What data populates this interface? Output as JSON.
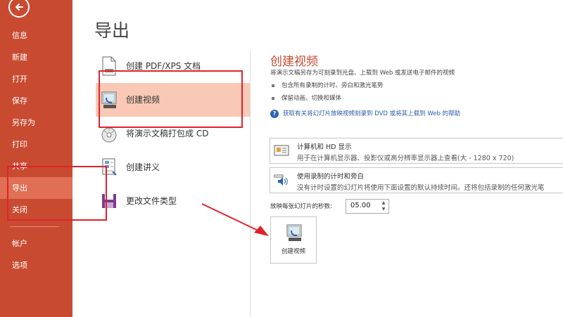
{
  "sidebar": {
    "items": [
      {
        "label": "信息"
      },
      {
        "label": "新建"
      },
      {
        "label": "打开"
      },
      {
        "label": "保存"
      },
      {
        "label": "另存为"
      },
      {
        "label": "打印"
      },
      {
        "label": "共享"
      },
      {
        "label": "导出"
      },
      {
        "label": "关闭"
      },
      {
        "label": "帐户"
      },
      {
        "label": "选项"
      }
    ]
  },
  "page": {
    "title": "导出"
  },
  "options": [
    {
      "label": "创建 PDF/XPS 文档",
      "icon": "pdf-document-icon"
    },
    {
      "label": "创建视频",
      "icon": "video-icon"
    },
    {
      "label": "将演示文稿打包成 CD",
      "icon": "cd-icon"
    },
    {
      "label": "创建讲义",
      "icon": "handout-icon"
    },
    {
      "label": "更改文件类型",
      "icon": "file-type-icon"
    }
  ],
  "detail": {
    "title": "创建视频",
    "description": "将演示文稿另存为可刻录到光盘、上载到 Web 或发送电子邮件的视频",
    "bullets": [
      "包含所有录制的计时、旁白和激光笔势",
      "保留动画、切换和媒体"
    ],
    "help_link": "获取有关将幻灯片放映视频刻录到 DVD 或将其上载到 Web 的帮助",
    "quality": {
      "title": "计算机和 HD 显示",
      "subtitle": "用于在计算机显示器、投影仪或高分辨率显示器上查看(大 - 1280 x 720)"
    },
    "timing": {
      "title": "使用录制的计时和旁白",
      "subtitle": "没有计时设置的幻灯片将使用下面设置的默认持续时间。还将包括录制的任何激光笔"
    },
    "seconds_label": "放映每张幻灯片的秒数:",
    "seconds_value": "05.00",
    "create_button": "创建视频"
  },
  "colors": {
    "sidebar": "#c84b31",
    "active": "#e16f55",
    "accent": "#c84b31",
    "selected": "#f9c9b5",
    "annotation": "#e0232a"
  }
}
